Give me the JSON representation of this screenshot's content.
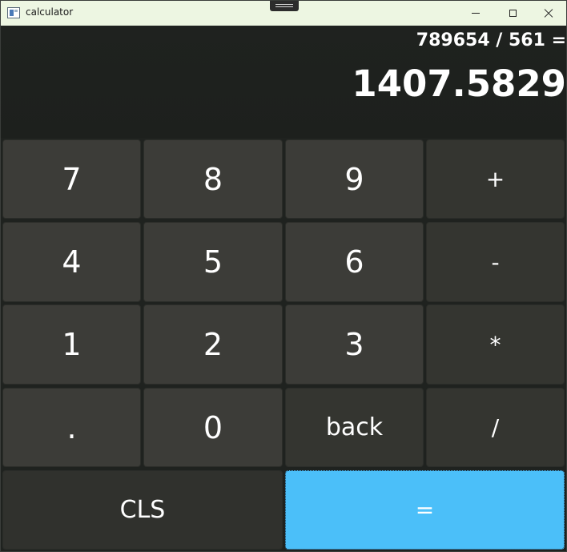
{
  "window": {
    "title": "calculator"
  },
  "display": {
    "expression": "789654 / 561 =",
    "result": "1407.5829"
  },
  "keys": {
    "seven": "7",
    "eight": "8",
    "nine": "9",
    "plus": "+",
    "four": "4",
    "five": "5",
    "six": "6",
    "minus": "-",
    "one": "1",
    "two": "2",
    "three": "3",
    "multiply": "*",
    "decimal": ".",
    "zero": "0",
    "back": "back",
    "divide": "/",
    "clear": "CLS",
    "equals": "="
  },
  "icons": {
    "app": "calculator-app-icon",
    "minimize": "minimize-icon",
    "maximize": "maximize-icon",
    "close": "close-icon"
  },
  "colors": {
    "titlebar": "#edf6e2",
    "background": "#1f221f",
    "key": "#3c3c38",
    "operator_key": "#343530",
    "equals_key": "#4bbff9",
    "text": "#ffffff"
  }
}
